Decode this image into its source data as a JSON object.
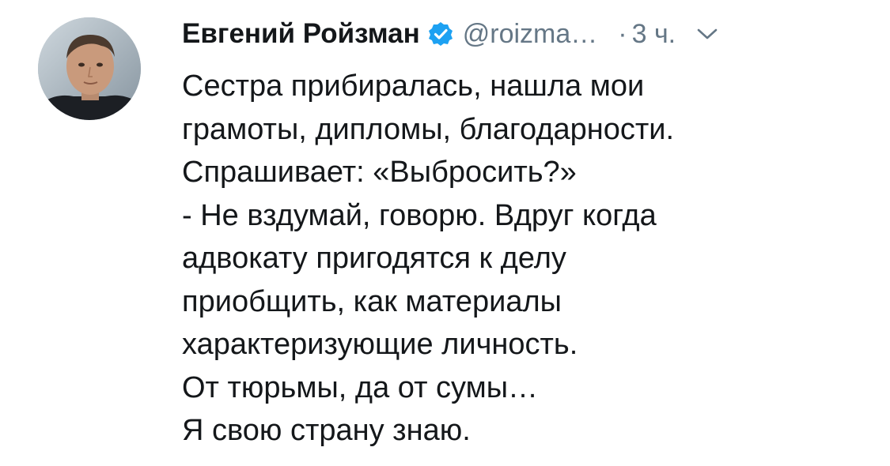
{
  "tweet": {
    "author": {
      "name": "Евгений Ройзман",
      "handle": "@roizma…",
      "verified": true,
      "avatar_icon": "profile-photo"
    },
    "time_separator": "·",
    "time": "3 ч.",
    "menu_icon": "chevron-down-icon",
    "text_lines": [
      "Сестра прибиралась, нашла мои",
      "грамоты, дипломы, благодарности.",
      "Спрашивает: «Выбросить?»",
      "- Не вздумай, говорю. Вдруг когда",
      "адвокату пригодятся к делу",
      "приобщить, как материалы",
      "характеризующие личность.",
      "От тюрьмы, да от сумы…",
      "Я свою страну знаю."
    ]
  },
  "colors": {
    "text": "#14171a",
    "secondary": "#657786",
    "verified_blue": "#1da1f2",
    "background": "#ffffff"
  }
}
